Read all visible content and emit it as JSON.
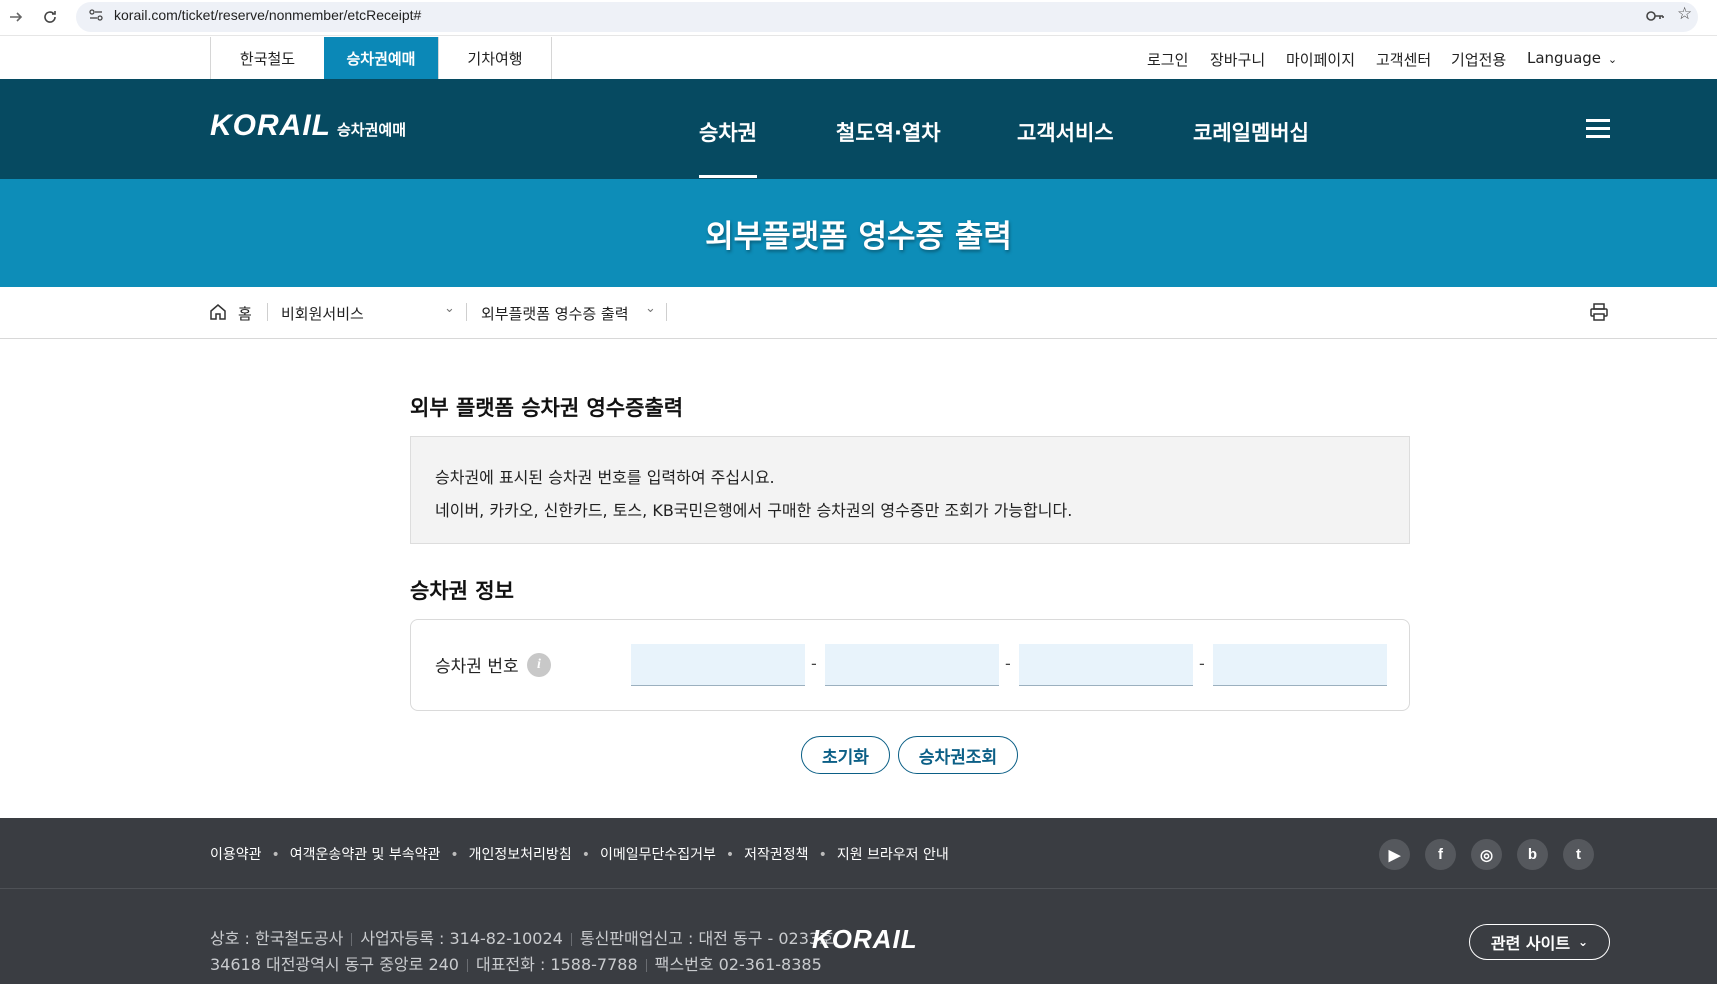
{
  "browser": {
    "url": "korail.com/ticket/reserve/nonmember/etcReceipt#"
  },
  "util_bar": {
    "tabs": [
      {
        "label": "한국철도"
      },
      {
        "label": "승차권예매"
      },
      {
        "label": "기차여행"
      }
    ],
    "links": [
      {
        "label": "로그인"
      },
      {
        "label": "장바구니"
      },
      {
        "label": "마이페이지"
      },
      {
        "label": "고객센터"
      },
      {
        "label": "기업전용"
      },
      {
        "label": "Language"
      }
    ]
  },
  "header": {
    "logo_main": "KORAIL",
    "logo_sub": "승차권예매",
    "nav": [
      {
        "label": "승차권"
      },
      {
        "label": "철도역·열차"
      },
      {
        "label": "고객서비스"
      },
      {
        "label": "코레일멤버십"
      }
    ]
  },
  "banner": {
    "title": "외부플랫폼 영수증 출력"
  },
  "breadcrumb": {
    "home": "홈",
    "level1": "비회원서비스",
    "level2": "외부플랫폼 영수증 출력"
  },
  "main": {
    "section_title": "외부 플랫폼 승차권 영수증출력",
    "info_lines": [
      "승차권에 표시된 승차권 번호를 입력하여 주십시요.",
      "네이버, 카카오, 신한카드, 토스, KB국민은행에서 구매한 승차권의 영수증만 조회가 가능합니다."
    ],
    "ticket_section_title": "승차권 정보",
    "ticket_label": "승차권 번호",
    "info_icon_glyph": "i",
    "dash": "-",
    "reset_button": "초기화",
    "search_button": "승차권조회"
  },
  "footer": {
    "links": [
      {
        "label": "이용약관"
      },
      {
        "label": "여객운송약관 및 부속약관"
      },
      {
        "label": "개인정보처리방침"
      },
      {
        "label": "이메일무단수집거부"
      },
      {
        "label": "저작권정책"
      },
      {
        "label": "지원 브라우저 안내"
      }
    ],
    "social": [
      {
        "name": "youtube-icon",
        "glyph": "▶"
      },
      {
        "name": "facebook-icon",
        "glyph": "f"
      },
      {
        "name": "instagram-icon",
        "glyph": "◎"
      },
      {
        "name": "blog-icon",
        "glyph": "b"
      },
      {
        "name": "twitter-icon",
        "glyph": "t"
      }
    ],
    "company": "상호 : 한국철도공사",
    "biz_reg": "사업자등록 : 314-82-10024",
    "mail_order": "통신판매업신고 : 대전 동구 - 0233호",
    "address": "34618 대전광역시 동구 중앙로 240",
    "phone": "대표전화 : 1588-7788",
    "fax": "팩스번호 02-361-8385",
    "logo": "KORAIL",
    "related_site": "관련 사이트"
  },
  "colors": {
    "header_bg": "#064a61",
    "banner_bg": "#0d8db8",
    "active_tab": "#0b88b7",
    "button_accent": "#0b5f86",
    "footer_bg": "#3a3d42"
  }
}
